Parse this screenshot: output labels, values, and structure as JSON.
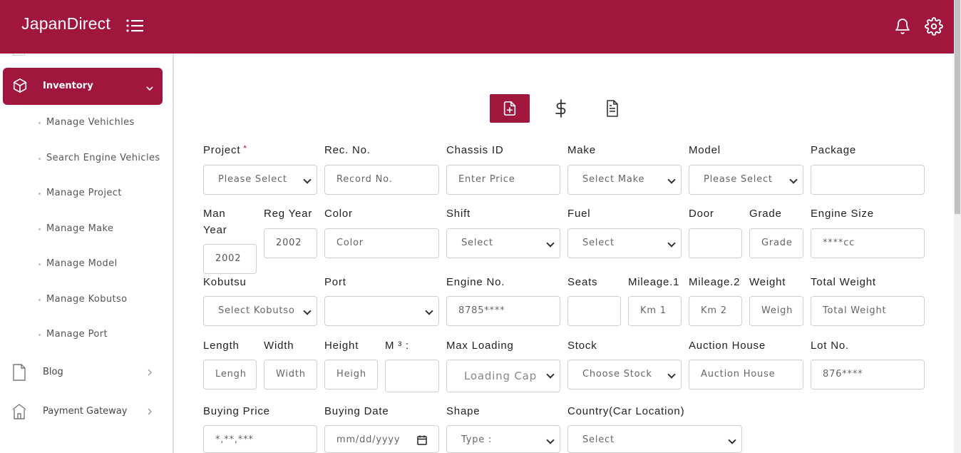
{
  "header": {
    "brand": "JapanDirect",
    "accent_color": "#a0163d",
    "icons": [
      "menu-icon",
      "bell-icon",
      "gear-icon"
    ]
  },
  "sidebar": {
    "active_item": {
      "label": "Inventory",
      "icon": "cube-icon"
    },
    "sub_items": [
      "Manage Vehichles",
      "Search Engine Vehicles",
      "Manage Project",
      "Manage Make",
      "Manage Model",
      "Manage Kobutso",
      "Manage Port"
    ],
    "items": [
      {
        "label": "Blog",
        "icon": "document-icon"
      },
      {
        "label": "Payment Gateway",
        "icon": "bank-icon"
      }
    ]
  },
  "tabs": {
    "icons": [
      "file-plus-icon",
      "dollar-icon",
      "file-text-icon"
    ],
    "active": "file-plus-icon"
  },
  "form": {
    "project": {
      "label": "Project",
      "required_mark": "*",
      "value": "Please Select"
    },
    "rec_no": {
      "label": "Rec. No.",
      "placeholder": "Record No."
    },
    "chassis_id": {
      "label": "Chassis ID",
      "placeholder": "Enter Price"
    },
    "make": {
      "label": "Make",
      "value": "Select Make"
    },
    "model": {
      "label": "Model",
      "value": "Please Select"
    },
    "package": {
      "label": "Package",
      "placeholder": ""
    },
    "man_year": {
      "label_1": "Man",
      "label_2": "Year",
      "value": "2002"
    },
    "reg_year": {
      "label": "Reg Year",
      "value": "2002"
    },
    "color": {
      "label": "Color",
      "placeholder": "Color"
    },
    "shift": {
      "label": "Shift",
      "value": "Select"
    },
    "fuel": {
      "label": "Fuel",
      "value": "Select"
    },
    "door": {
      "label": "Door",
      "placeholder": ""
    },
    "grade": {
      "label": "Grade",
      "placeholder": "Grade"
    },
    "engine_size": {
      "label": "Engine Size",
      "placeholder": "****cc"
    },
    "kobutsu": {
      "label": "Kobutsu",
      "value": "Select Kobutso"
    },
    "port": {
      "label": "Port",
      "value": ""
    },
    "engine_no": {
      "label": "Engine No.",
      "placeholder": "8785****"
    },
    "seats": {
      "label": "Seats",
      "placeholder": ""
    },
    "mileage_1": {
      "label": "Mileage.1",
      "placeholder": "Km 1"
    },
    "mileage_2": {
      "label": "Mileage.2",
      "placeholder": "Km 2"
    },
    "weight": {
      "label": "Weight",
      "placeholder": "Weigh"
    },
    "total_weight": {
      "label": "Total Weight",
      "placeholder": "Total Weight"
    },
    "length": {
      "label": "Length",
      "placeholder": "Lengh"
    },
    "width": {
      "label": "Width",
      "placeholder": "Width"
    },
    "height": {
      "label": "Height",
      "placeholder": "Heigh"
    },
    "m3": {
      "label": "M ³ :",
      "placeholder": ""
    },
    "max_loading": {
      "label": "Max Loading",
      "value": "Loading Cap"
    },
    "stock": {
      "label": "Stock",
      "value": "Choose Stock"
    },
    "auction_house": {
      "label": "Auction House",
      "placeholder": "Auction House"
    },
    "lot_no": {
      "label": "Lot No.",
      "placeholder": "876****"
    },
    "buying_price": {
      "label": "Buying Price",
      "placeholder": "*,**,***"
    },
    "buying_date": {
      "label": "Buying Date",
      "placeholder": "mm/dd/yyyy"
    },
    "shape": {
      "label": "Shape",
      "value": "Type :"
    },
    "country": {
      "label": "Country(Car Location)",
      "value": "Select"
    }
  }
}
